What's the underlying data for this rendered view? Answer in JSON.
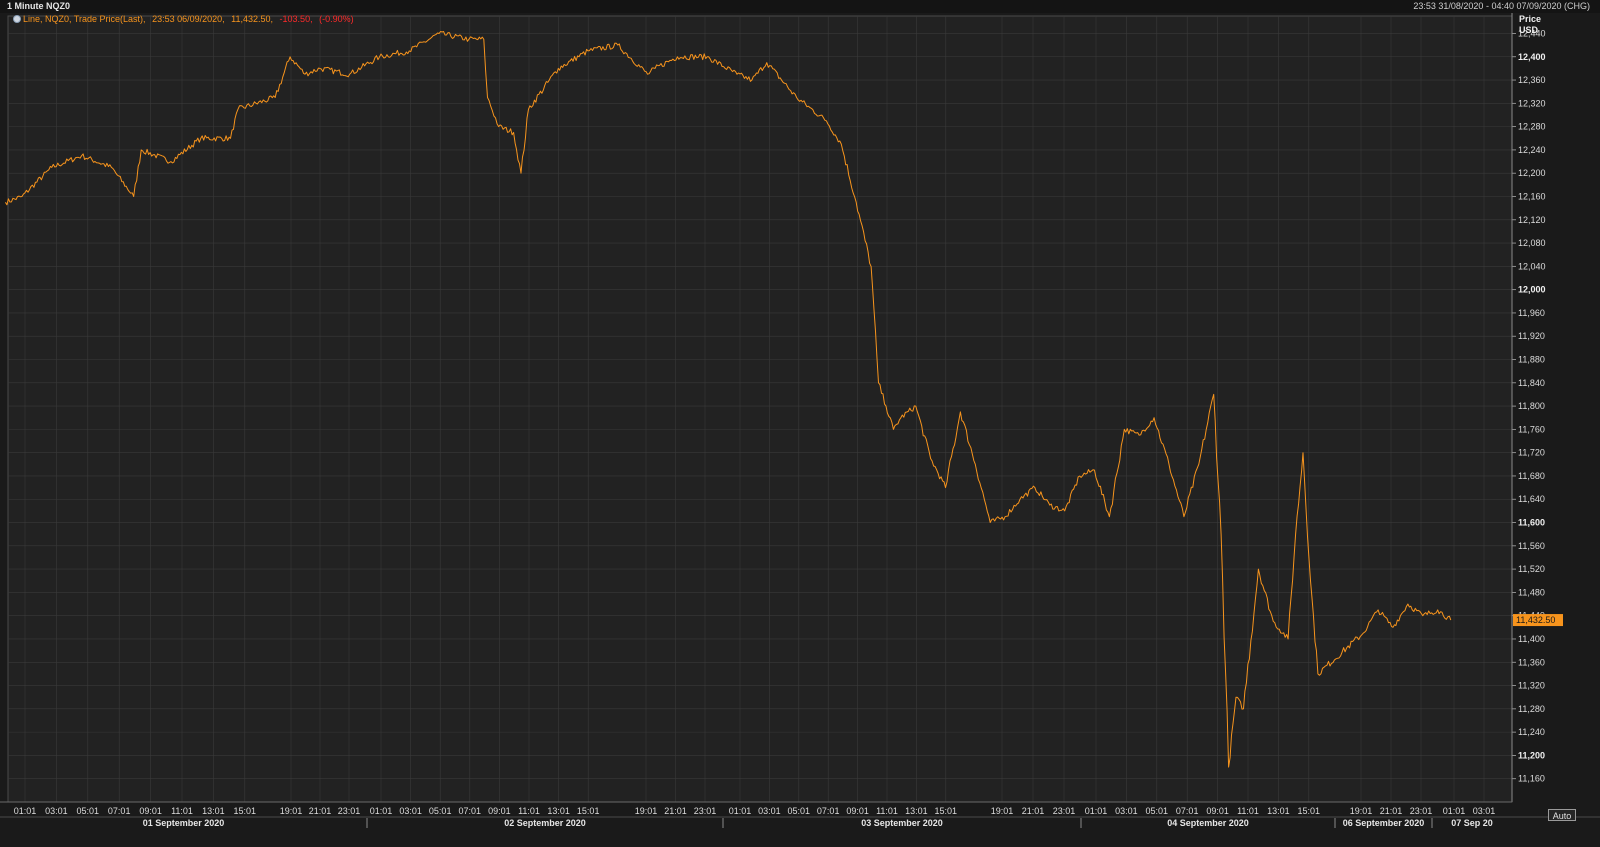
{
  "window": {
    "title": "1 Minute NQZ0",
    "range": "23:53 31/08/2020 - 04:40 07/09/2020 (CHG)"
  },
  "legend": {
    "series": "Line, NQZ0, Trade Price(Last),",
    "datetime": "23:53 06/09/2020,",
    "last": "11,432.50,",
    "change": "-103.50,",
    "change_pct": "(-0.90%)",
    "series_color": "#f7941d",
    "change_color": "#ff2a2a"
  },
  "axis": {
    "title_line1": "Price",
    "title_line2": "USD",
    "last_value_label": "11,432.50",
    "auto_label": "Auto"
  },
  "colors": {
    "background": "#222222",
    "grid": "#3a3a3a",
    "line": "#f7941d",
    "badge": "#f7941d"
  },
  "chart_data": {
    "type": "line",
    "title": "1 Minute NQZ0",
    "ylabel": "Price USD",
    "ylim": [
      11120,
      12470
    ],
    "y_ticks": [
      11160,
      11200,
      11240,
      11280,
      11320,
      11360,
      11400,
      11440,
      11480,
      11520,
      11560,
      11600,
      11640,
      11680,
      11720,
      11760,
      11800,
      11840,
      11880,
      11920,
      11960,
      12000,
      12040,
      12080,
      12120,
      12160,
      12200,
      12240,
      12280,
      12320,
      12360,
      12400,
      12440
    ],
    "y_ticks_major": [
      11200,
      11600,
      12000,
      12400
    ],
    "x_tick_labels": [
      "01:01",
      "03:01",
      "05:01",
      "07:01",
      "09:01",
      "11:01",
      "13:01",
      "15:01",
      "19:01",
      "21:01",
      "23:01",
      "01:01",
      "03:01",
      "05:01",
      "07:01",
      "09:01",
      "11:01",
      "13:01",
      "15:01",
      "19:01",
      "21:01",
      "23:01",
      "01:01",
      "03:01",
      "05:01",
      "07:01",
      "09:01",
      "11:01",
      "13:01",
      "15:01",
      "19:01",
      "21:01",
      "23:01",
      "01:01",
      "03:01",
      "05:01",
      "07:01",
      "09:01",
      "11:01",
      "13:01",
      "15:01",
      "19:01",
      "21:01",
      "23:01",
      "01:01",
      "03:01"
    ],
    "day_labels": [
      "01 September 2020",
      "02 September 2020",
      "03 September 2020",
      "04 September 2020",
      "06 September 2020",
      "07 Sep 20"
    ],
    "legend_position": "top-left",
    "grid": true,
    "series": [
      {
        "name": "Trade Price(Last)",
        "x": [
          "08-31 23:53",
          "09-01 01:00",
          "09-01 03:00",
          "09-01 05:00",
          "09-01 07:00",
          "09-01 08:30",
          "09-01 09:00",
          "09-01 11:00",
          "09-01 13:00",
          "09-01 15:00",
          "09-01 15:30",
          "09-01 18:00",
          "09-01 19:00",
          "09-01 20:00",
          "09-01 21:00",
          "09-01 23:00",
          "09-02 01:00",
          "09-02 03:00",
          "09-02 05:00",
          "09-02 07:00",
          "09-02 08:00",
          "09-02 08:15",
          "09-02 09:00",
          "09-02 10:00",
          "09-02 10:30",
          "09-02 11:00",
          "09-02 13:00",
          "09-02 15:00",
          "09-02 17:00",
          "09-02 19:00",
          "09-02 19:30",
          "09-02 21:00",
          "09-02 23:00",
          "09-03 01:00",
          "09-03 02:00",
          "09-03 03:00",
          "09-03 05:00",
          "09-03 07:00",
          "09-03 08:00",
          "09-03 09:00",
          "09-03 10:00",
          "09-03 10:30",
          "09-03 11:00",
          "09-03 11:30",
          "09-03 12:00",
          "09-03 13:00",
          "09-03 14:00",
          "09-03 15:00",
          "09-03 16:00",
          "09-03 17:00",
          "09-03 18:00",
          "09-03 19:00",
          "09-03 20:00",
          "09-03 21:00",
          "09-03 22:00",
          "09-03 23:00",
          "09-04 00:00",
          "09-04 01:00",
          "09-04 02:00",
          "09-04 03:00",
          "09-04 04:00",
          "09-04 05:00",
          "09-04 06:00",
          "09-04 07:00",
          "09-04 08:00",
          "09-04 09:00",
          "09-04 09:30",
          "09-04 10:00",
          "09-04 10:30",
          "09-04 11:00",
          "09-04 12:00",
          "09-04 13:00",
          "09-04 14:00",
          "09-04 14:30",
          "09-04 15:00",
          "09-04 15:30",
          "09-04 16:00",
          "09-06 18:00",
          "09-06 19:00",
          "09-06 20:00",
          "09-06 21:00",
          "09-06 22:00",
          "09-06 23:00",
          "09-06 23:53"
        ],
        "values": [
          12150,
          12160,
          12210,
          12230,
          12210,
          12160,
          12240,
          12220,
          12260,
          12260,
          12310,
          12330,
          12400,
          12370,
          12380,
          12370,
          12400,
          12410,
          12440,
          12430,
          12430,
          12330,
          12280,
          12270,
          12200,
          12310,
          12380,
          12410,
          12420,
          12370,
          12380,
          12400,
          12400,
          12370,
          12360,
          12390,
          12330,
          12290,
          12250,
          12150,
          12040,
          11840,
          11800,
          11760,
          11780,
          11800,
          11710,
          11660,
          11790,
          11700,
          11600,
          11610,
          11640,
          11660,
          11630,
          11620,
          11680,
          11690,
          11610,
          11760,
          11750,
          11780,
          11700,
          11610,
          11700,
          11820,
          11580,
          11180,
          11300,
          11280,
          11520,
          11430,
          11400,
          11580,
          11720,
          11500,
          11340,
          11410,
          11450,
          11420,
          11460,
          11440,
          11450,
          11432.5
        ]
      }
    ]
  }
}
